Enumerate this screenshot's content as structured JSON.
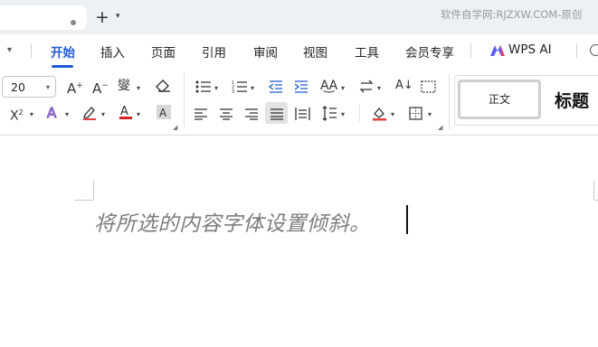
{
  "tabbar": {
    "new_tab_glyph": "+",
    "watermark": "软件自学网:RJZXW.COM-原创"
  },
  "menu": {
    "items": [
      "开始",
      "插入",
      "页面",
      "引用",
      "审阅",
      "视图",
      "工具",
      "会员专享"
    ],
    "active_index": 0,
    "ai_label": "WPS AI"
  },
  "ribbon": {
    "font_size": "20",
    "styles": {
      "normal": "正文",
      "heading": "标题"
    }
  },
  "document": {
    "text": "将所选的内容字体设置倾斜。",
    "text_style": "italic"
  },
  "colors": {
    "accent": "#1f59d8",
    "tabbar_bg": "#eef0f4",
    "font_color_bar": "#d02525",
    "highlight_bar": "#e64040"
  }
}
